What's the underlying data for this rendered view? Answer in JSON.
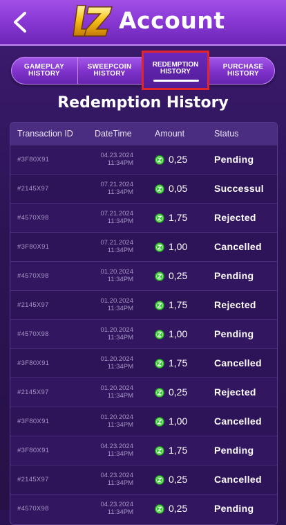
{
  "header": {
    "title": "Account",
    "logo_text": "LZ"
  },
  "tabs": [
    {
      "label": "GAMEPLAY\nHISTORY",
      "active": false
    },
    {
      "label": "SWEEPCOIN\nHISTORY",
      "active": false
    },
    {
      "label": "REDEMPTION\nHISTORY",
      "active": true
    },
    {
      "label": "PURCHASE\nHISTORY",
      "active": false
    }
  ],
  "section_title": "Redemption History",
  "table": {
    "columns": [
      "Transaction ID",
      "DateTime",
      "Amount",
      "Status"
    ],
    "rows": [
      {
        "id": "#3F80X91",
        "date": "04.23.2024",
        "time": "11:34PM",
        "amount": "0,25",
        "status": "Pending"
      },
      {
        "id": "#2145X97",
        "date": "07.21.2024",
        "time": "11:34PM",
        "amount": "0,05",
        "status": "Successul"
      },
      {
        "id": "#4570X98",
        "date": "07.21.2024",
        "time": "11:34PM",
        "amount": "1,75",
        "status": "Rejected"
      },
      {
        "id": "#3F80X91",
        "date": "07.21.2024",
        "time": "11:34PM",
        "amount": "1,00",
        "status": "Cancelled"
      },
      {
        "id": "#4570X98",
        "date": "01.20.2024",
        "time": "11:34PM",
        "amount": "0,25",
        "status": "Pending"
      },
      {
        "id": "#2145X97",
        "date": "01.20.2024",
        "time": "11:34PM",
        "amount": "1,75",
        "status": "Rejected"
      },
      {
        "id": "#4570X98",
        "date": "01.20.2024",
        "time": "11:34PM",
        "amount": "1,00",
        "status": "Pending"
      },
      {
        "id": "#3F80X91",
        "date": "01.20.2024",
        "time": "11:34PM",
        "amount": "1,75",
        "status": "Cancelled"
      },
      {
        "id": "#2145X97",
        "date": "01.20.2024",
        "time": "11:34PM",
        "amount": "0,25",
        "status": "Rejected"
      },
      {
        "id": "#3F80X91",
        "date": "01.20.2024",
        "time": "11:34PM",
        "amount": "1,00",
        "status": "Cancelled"
      },
      {
        "id": "#3F80X91",
        "date": "04.23.2024",
        "time": "11:34PM",
        "amount": "1,75",
        "status": "Pending"
      },
      {
        "id": "#2145X97",
        "date": "04.23.2024",
        "time": "11:34PM",
        "amount": "0,25",
        "status": "Cancelled"
      },
      {
        "id": "#4570X98",
        "date": "04.23.2024",
        "time": "11:34PM",
        "amount": "0,25",
        "status": "Pending"
      }
    ]
  },
  "colors": {
    "accent_purple": "#8a39d6",
    "background": "#2a1352",
    "highlight_border": "#e2242b",
    "coin_green": "#3cc63c"
  },
  "icons": {
    "back": "chevron-left-icon",
    "coin": "sweep-coin-icon"
  }
}
